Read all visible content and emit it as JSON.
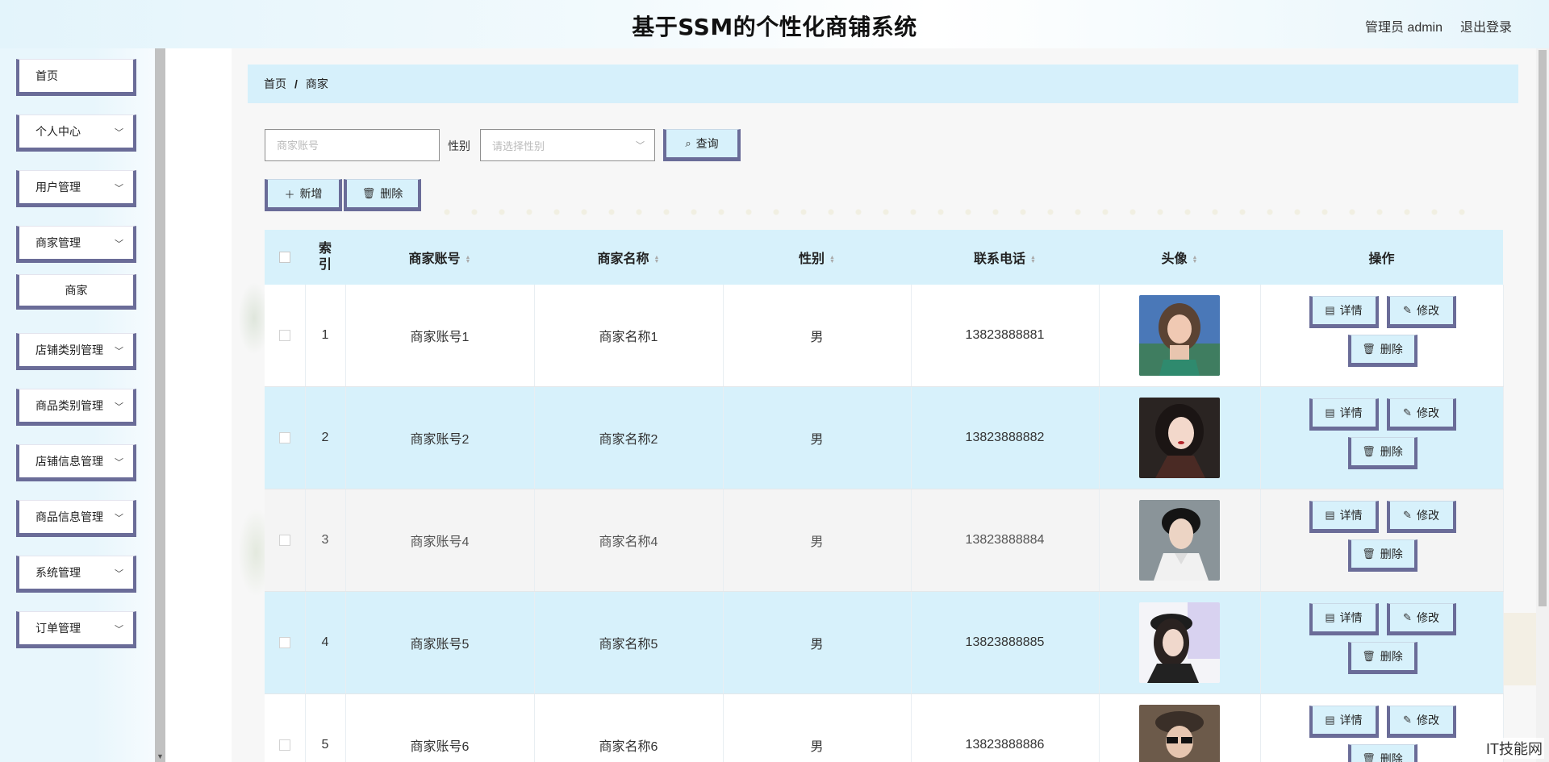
{
  "header": {
    "title": "基于SSM的个性化商铺系统",
    "user": "管理员 admin",
    "logout": "退出登录"
  },
  "sidebar": {
    "items": [
      {
        "label": "首页",
        "expandable": false
      },
      {
        "label": "个人中心",
        "expandable": true
      },
      {
        "label": "用户管理",
        "expandable": true
      },
      {
        "label": "商家管理",
        "expandable": true
      },
      {
        "label": "商家",
        "sub": true
      },
      {
        "label": "店铺类别管理",
        "expandable": true
      },
      {
        "label": "商品类别管理",
        "expandable": true
      },
      {
        "label": "店铺信息管理",
        "expandable": true
      },
      {
        "label": "商品信息管理",
        "expandable": true
      },
      {
        "label": "系统管理",
        "expandable": true
      },
      {
        "label": "订单管理",
        "expandable": true
      }
    ]
  },
  "breadcrumb": {
    "home": "首页",
    "sep": "/",
    "current": "商家"
  },
  "search": {
    "account_placeholder": "商家账号",
    "gender_label": "性别",
    "gender_placeholder": "请选择性别",
    "query_label": "查询"
  },
  "actions": {
    "add_label": "新增",
    "delete_label": "删除"
  },
  "table": {
    "columns": [
      "索引",
      "商家账号",
      "商家名称",
      "性别",
      "联系电话",
      "头像",
      "操作"
    ],
    "index_col_lines": [
      "索",
      "引"
    ],
    "rows": [
      {
        "index": "1",
        "account": "商家账号1",
        "name": "商家名称1",
        "gender": "男",
        "phone": "13823888881",
        "avatar": "avatar-woman-1"
      },
      {
        "index": "2",
        "account": "商家账号2",
        "name": "商家名称2",
        "gender": "男",
        "phone": "13823888882",
        "avatar": "avatar-woman-2"
      },
      {
        "index": "3",
        "account": "商家账号4",
        "name": "商家名称4",
        "gender": "男",
        "phone": "13823888884",
        "avatar": "avatar-man-1"
      },
      {
        "index": "4",
        "account": "商家账号5",
        "name": "商家名称5",
        "gender": "男",
        "phone": "13823888885",
        "avatar": "avatar-woman-3"
      },
      {
        "index": "5",
        "account": "商家账号6",
        "name": "商家名称6",
        "gender": "男",
        "phone": "13823888886",
        "avatar": "avatar-man-2"
      }
    ],
    "op_labels": {
      "detail": "详情",
      "edit": "修改",
      "delete": "删除"
    }
  },
  "colors": {
    "accent": "#6a6c98",
    "highlight": "#d7f1fb",
    "header_bg": "#e3f4fb"
  },
  "watermark": "IT技能网"
}
